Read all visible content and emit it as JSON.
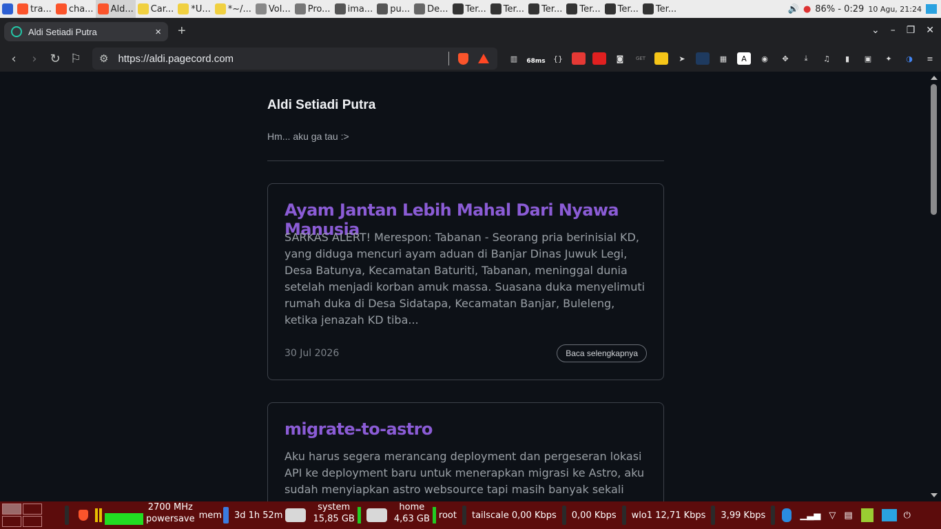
{
  "topbar": {
    "tasks": [
      {
        "label": "tra...",
        "color": "#fb542b"
      },
      {
        "label": "cha...",
        "color": "#fb542b"
      },
      {
        "label": "Ald...",
        "color": "#fb542b"
      },
      {
        "label": "Car...",
        "color": "#f0d040"
      },
      {
        "label": "*U...",
        "color": "#f0d040"
      },
      {
        "label": "*~/...",
        "color": "#f0d040"
      },
      {
        "label": "Vol...",
        "color": "#888888"
      },
      {
        "label": "Pro...",
        "color": "#777777"
      },
      {
        "label": "ima...",
        "color": "#555555"
      },
      {
        "label": "pu...",
        "color": "#555555"
      },
      {
        "label": "De...",
        "color": "#666666"
      },
      {
        "label": "Ter...",
        "color": "#333333"
      },
      {
        "label": "Ter...",
        "color": "#333333"
      },
      {
        "label": "Ter...",
        "color": "#333333"
      },
      {
        "label": "Ter...",
        "color": "#333333"
      },
      {
        "label": "Ter...",
        "color": "#333333"
      },
      {
        "label": "Ter...",
        "color": "#333333"
      }
    ],
    "battery": "86% - 0:29",
    "clock": "10 Agu, 21:24"
  },
  "browser": {
    "tab_title": "Aldi Setiadi Putra",
    "tab_close": "×",
    "new_tab": "+",
    "url": "https://aldi.pagecord.com",
    "ext_ping": "68ms"
  },
  "page": {
    "site_title": "Aldi Setiadi Putra",
    "site_description": "Hm... aku ga tau :>",
    "posts": [
      {
        "title": "Ayam Jantan Lebih Mahal Dari Nyawa Manusia",
        "excerpt": "SARKAS ALERT! Merespon: Tabanan - Seorang pria berinisial KD, yang diduga mencuri ayam aduan di Banjar Dinas Juwuk Legi, Desa Batunya, Kecamatan Baturiti, Tabanan, meninggal dunia setelah menjadi korban amuk massa. Suasana duka menyelimuti rumah duka di Desa Sidatapa, Kecamatan Banjar, Buleleng, ketika jenazah KD tiba...",
        "date": "30 Jul 2026",
        "read_more": "Baca selengkapnya"
      },
      {
        "title": "migrate-to-astro",
        "excerpt": "Aku harus segera merancang deployment dan pergeseran lokasi API ke deployment baru untuk menerapkan migrasi ke Astro, aku sudah menyiapkan astro websource tapi masih banyak sekali pertimbangan"
      }
    ]
  },
  "taskbar": {
    "cpu_freq": "2700 MHz",
    "governor": "powersave",
    "mem_label": "mem",
    "uptime": "3d 1h 52m",
    "drive1_name": "system",
    "drive1_size": "15,85 GB",
    "drive2_name": "home",
    "drive2_size": "4,63 GB",
    "root_label": "root",
    "tailscale": "tailscale 0,00 Kbps",
    "tailscale_up": "0,00 Kbps",
    "wlo1": "wlo1   12,71 Kbps",
    "wlo1_up": "3,99 Kbps"
  }
}
